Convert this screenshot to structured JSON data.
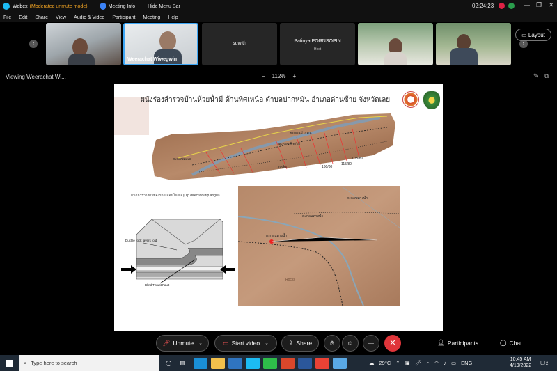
{
  "window": {
    "app_name": "Webex",
    "mode": "(Moderated unmute mode)",
    "meeting_info": "Meeting Info",
    "hide_menu_bar": "Hide Menu Bar",
    "timer": "02:24:23"
  },
  "menu": [
    "File",
    "Edit",
    "Share",
    "View",
    "Audio & Video",
    "Participant",
    "Meeting",
    "Help"
  ],
  "participants": [
    {
      "name": "",
      "type": "video"
    },
    {
      "name": "Weerachat Wiwegwin",
      "type": "video",
      "active": true
    },
    {
      "name": "suwith",
      "type": "name-only"
    },
    {
      "name": "Patinya PORNSOPIN",
      "role": "Host",
      "type": "name-only"
    },
    {
      "name": "",
      "type": "video"
    },
    {
      "name": "",
      "type": "video"
    }
  ],
  "layout_button": "Layout",
  "viewing": "Viewing Weerachat Wi...",
  "zoom": {
    "minus": "−",
    "value": "112%",
    "plus": "+"
  },
  "slide": {
    "title": "ผนังร่องสำรวจบ้านห้วยน้ำมี ด้านทิศเหนือ ตำบลปากหมัน อำเภอด่านซ้าย จังหวัดเลย",
    "caption": "แนวการวางตัวของรอยเลื่อนในหิน (Dip direction/dip angle)",
    "panorama_labels": [
      "ตะกอนปากทร.",
      "ตะกอนขั้นแรก",
      "ตะกอนทะเล",
      "rocks",
      "160/80",
      "115/80",
      "075/80"
    ],
    "diagram_labels": [
      "Ductile rock layers fold",
      "Blind Thrust Fault"
    ],
    "photo_labels": [
      "ตะกอนทางน้ำ",
      "ตะกอนทางน้ำ",
      "ตะกอนทางน้ำ",
      "Rocks"
    ]
  },
  "controls": {
    "unmute": "Unmute",
    "start_video": "Start video",
    "share": "Share",
    "participants": "Participants",
    "chat": "Chat"
  },
  "taskbar": {
    "search_placeholder": "Type here to search",
    "weather": "29°C",
    "lang": "ENG",
    "time": "10:45 AM",
    "date": "4/19/2022",
    "notif_count": "2"
  }
}
